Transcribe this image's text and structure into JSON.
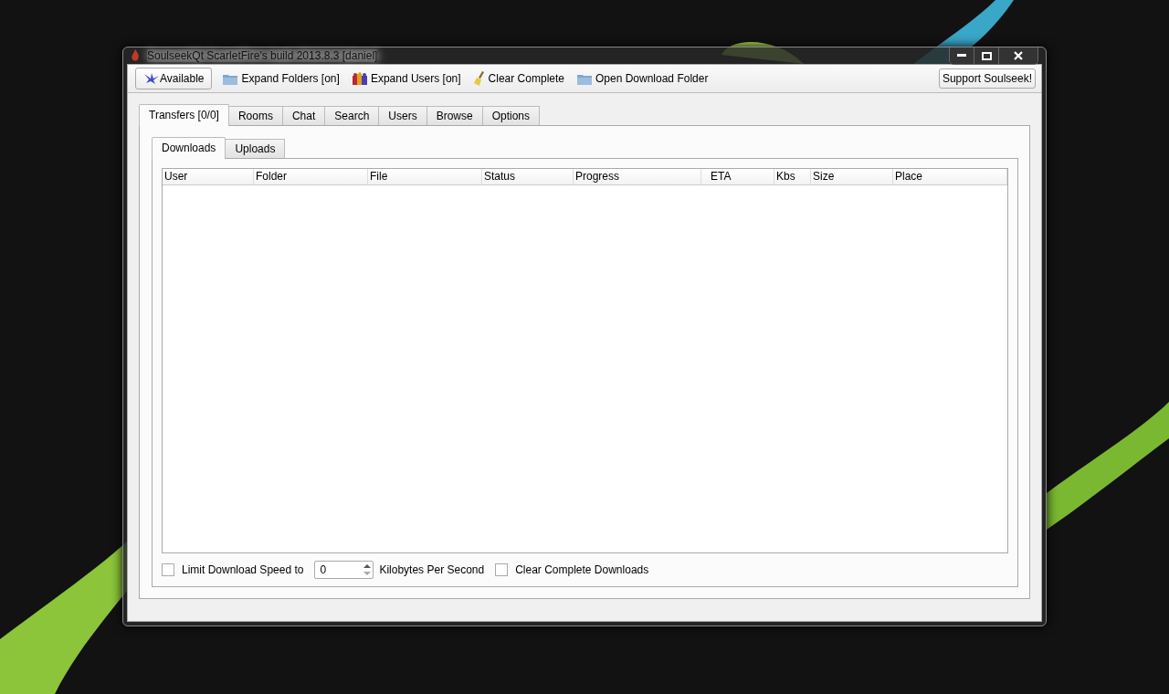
{
  "window": {
    "title": "SoulseekQt ScarletFire's build 2013.8.3 [daniel]"
  },
  "toolbar": {
    "items": [
      {
        "kind": "status",
        "label": "Available"
      },
      {
        "kind": "folder",
        "label": "Expand Folders [on]"
      },
      {
        "kind": "users",
        "label": "Expand Users [on]"
      },
      {
        "kind": "broom",
        "label": "Clear Complete"
      },
      {
        "kind": "folder",
        "label": "Open Download Folder"
      }
    ],
    "support_button": "Support Soulseek!"
  },
  "tabs": [
    {
      "label": "Transfers [0/0]",
      "selected": true
    },
    {
      "label": "Rooms",
      "selected": false
    },
    {
      "label": "Chat",
      "selected": false
    },
    {
      "label": "Search",
      "selected": false
    },
    {
      "label": "Users",
      "selected": false
    },
    {
      "label": "Browse",
      "selected": false
    },
    {
      "label": "Options",
      "selected": false
    }
  ],
  "subtabs": [
    {
      "label": "Downloads",
      "selected": true
    },
    {
      "label": "Uploads",
      "selected": false
    }
  ],
  "table": {
    "columns": [
      "User",
      "Folder",
      "File",
      "Status",
      "Progress",
      "ETA",
      "Kbs",
      "Size",
      "Place"
    ]
  },
  "footer": {
    "limit": {
      "label": "Limit Download Speed to",
      "checked": false
    },
    "speed": {
      "value": "0"
    },
    "unit": "Kilobytes Per Second",
    "clear": {
      "label": "Clear Complete Downloads",
      "checked": false
    }
  }
}
